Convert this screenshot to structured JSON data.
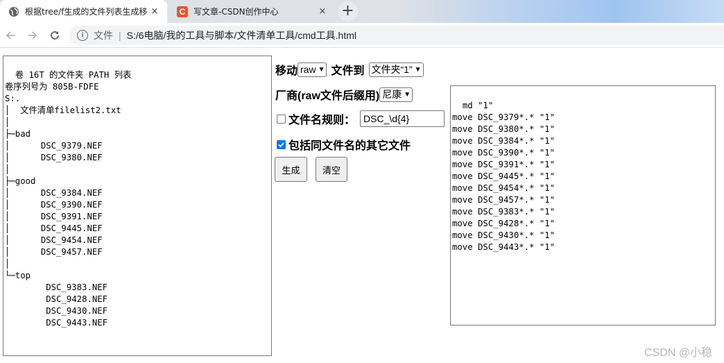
{
  "browser": {
    "tabs": [
      {
        "title": "根据tree/f生成的文件列表生成移",
        "active": true
      },
      {
        "title": "写文章-CSDN创作中心",
        "active": false
      }
    ],
    "new_tab_symbol": "+",
    "close_symbol": "×",
    "csdn_favicon_letter": "C",
    "address": {
      "info_symbol": "i",
      "scheme_label": "文件",
      "separator": "|",
      "url": "S:/6电脑/我的工具与脚本/文件清单工具/cmd工具.html"
    }
  },
  "tree_listing": "卷 16T 的文件夹 PATH 列表\n卷序列号为 805B-FDFE\nS:.\n│  文件清单filelist2.txt\n│\n├─bad\n│      DSC_9379.NEF\n│      DSC_9380.NEF\n│\n├─good\n│      DSC_9384.NEF\n│      DSC_9390.NEF\n│      DSC_9391.NEF\n│      DSC_9445.NEF\n│      DSC_9454.NEF\n│      DSC_9457.NEF\n│\n└─top\n        DSC_9383.NEF\n        DSC_9428.NEF\n        DSC_9430.NEF\n        DSC_9443.NEF",
  "controls": {
    "move_label": "移动",
    "type_select": "raw",
    "to_label": "文件到",
    "folder_select": "文件夹“1”",
    "maker_label": "厂商(raw文件后缀用)",
    "maker_select": "尼康",
    "rule_label": "文件名规则：",
    "rule_checked": false,
    "rule_value": "DSC_\\d{4}",
    "same_name_label": "包括同文件名的其它文件",
    "same_name_checked": true,
    "generate_button": "生成",
    "clear_button": "清空"
  },
  "output": "md \"1\"\nmove DSC_9379*.* \"1\"\nmove DSC_9380*.* \"1\"\nmove DSC_9384*.* \"1\"\nmove DSC_9390*.* \"1\"\nmove DSC_9391*.* \"1\"\nmove DSC_9445*.* \"1\"\nmove DSC_9454*.* \"1\"\nmove DSC_9457*.* \"1\"\nmove DSC_9383*.* \"1\"\nmove DSC_9428*.* \"1\"\nmove DSC_9430*.* \"1\"\nmove DSC_9443*.* \"1\"",
  "watermark": "CSDN @小稳"
}
